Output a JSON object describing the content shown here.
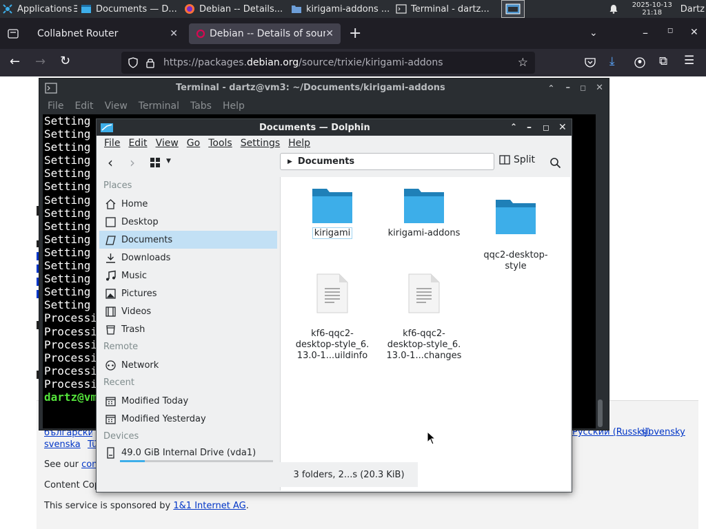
{
  "panel": {
    "apps_label": "Applications",
    "tasks": [
      {
        "label": "Documents — D..."
      },
      {
        "label": "Debian -- Details..."
      },
      {
        "label": "kirigami-addons ..."
      },
      {
        "label": "Terminal - dartz..."
      }
    ],
    "clock_date": "2025-10-13",
    "clock_time": "21:18",
    "user": "Dartz"
  },
  "firefox": {
    "tabs": [
      {
        "label": "Collabnet Router"
      },
      {
        "label": "Debian -- Details of source"
      }
    ],
    "url_prefix": "https://packages.",
    "url_host": "debian.org",
    "url_path": "/source/trixie/kirigami-addons"
  },
  "webpage": {
    "lang_link_left": "български (Bălgarski)",
    "lang_link_right1": "Русский (Russkij)",
    "lang_link_right2": "slovensky",
    "lang_svenska": "svenska",
    "lang_turkce": "Türkçe",
    "see_our_prefix": "See our",
    "contact_link": "contact page",
    "content_copyright": "Content Copyright",
    "sponsor_prefix": "This service is sponsored by",
    "sponsor_link": "1&1 Internet AG",
    "sponsor_suffix": "."
  },
  "terminal": {
    "title": "Terminal - dartz@vm3: ~/Documents/kirigami-addons",
    "menu": [
      "File",
      "Edit",
      "View",
      "Terminal",
      "Tabs",
      "Help"
    ],
    "lines": [
      "Setting",
      "Setting",
      "Setting",
      "Setting",
      "Setting",
      "Setting",
      "Setting",
      "Setting",
      "Setting",
      "Setting",
      "Setting",
      "Setting",
      "Setting",
      "Setting",
      "Setting",
      "Processi",
      "Processi",
      "Processi",
      "Processi",
      "Processi",
      "Processi"
    ],
    "prompt": "dartz@vm"
  },
  "dolphin": {
    "title": "Documents — Dolphin",
    "menu": [
      "File",
      "Edit",
      "View",
      "Go",
      "Tools",
      "Settings",
      "Help"
    ],
    "breadcrumb": "Documents",
    "split_label": "Split",
    "places_heading": "Places",
    "places": [
      {
        "label": "Home",
        "icon": "home-icon"
      },
      {
        "label": "Desktop",
        "icon": "desktop-icon"
      },
      {
        "label": "Documents",
        "icon": "documents-icon"
      },
      {
        "label": "Downloads",
        "icon": "downloads-icon"
      },
      {
        "label": "Music",
        "icon": "music-icon"
      },
      {
        "label": "Pictures",
        "icon": "pictures-icon"
      },
      {
        "label": "Videos",
        "icon": "videos-icon"
      },
      {
        "label": "Trash",
        "icon": "trash-icon"
      }
    ],
    "remote_heading": "Remote",
    "remote": [
      {
        "label": "Network",
        "icon": "network-icon"
      }
    ],
    "recent_heading": "Recent",
    "recent": [
      {
        "label": "Modified Today",
        "icon": "calendar-icon"
      },
      {
        "label": "Modified Yesterday",
        "icon": "calendar-icon"
      }
    ],
    "devices_heading": "Devices",
    "devices": [
      {
        "label": "49.0 GiB Internal Drive (vda1)",
        "icon": "drive-icon",
        "usage_fraction": 0.16
      }
    ],
    "files": [
      {
        "name": "kirigami",
        "type": "folder"
      },
      {
        "name": "kirigami-addons",
        "type": "folder"
      },
      {
        "name": "qqc2-desktop-\nstyle",
        "type": "folder"
      },
      {
        "name": "kf6-qqc2-\ndesktop-style_6.\n13.0-1...uildinfo",
        "type": "text-file"
      },
      {
        "name": "kf6-qqc2-\ndesktop-style_6.\n13.0-1...changes",
        "type": "text-file"
      }
    ],
    "status": "3 folders, 2...s (20.3 KiB)"
  },
  "colors": {
    "folder_blue": "#3daee9",
    "selection_bg": "#c2e0f5",
    "terminal_prompt": "#54e33b"
  }
}
